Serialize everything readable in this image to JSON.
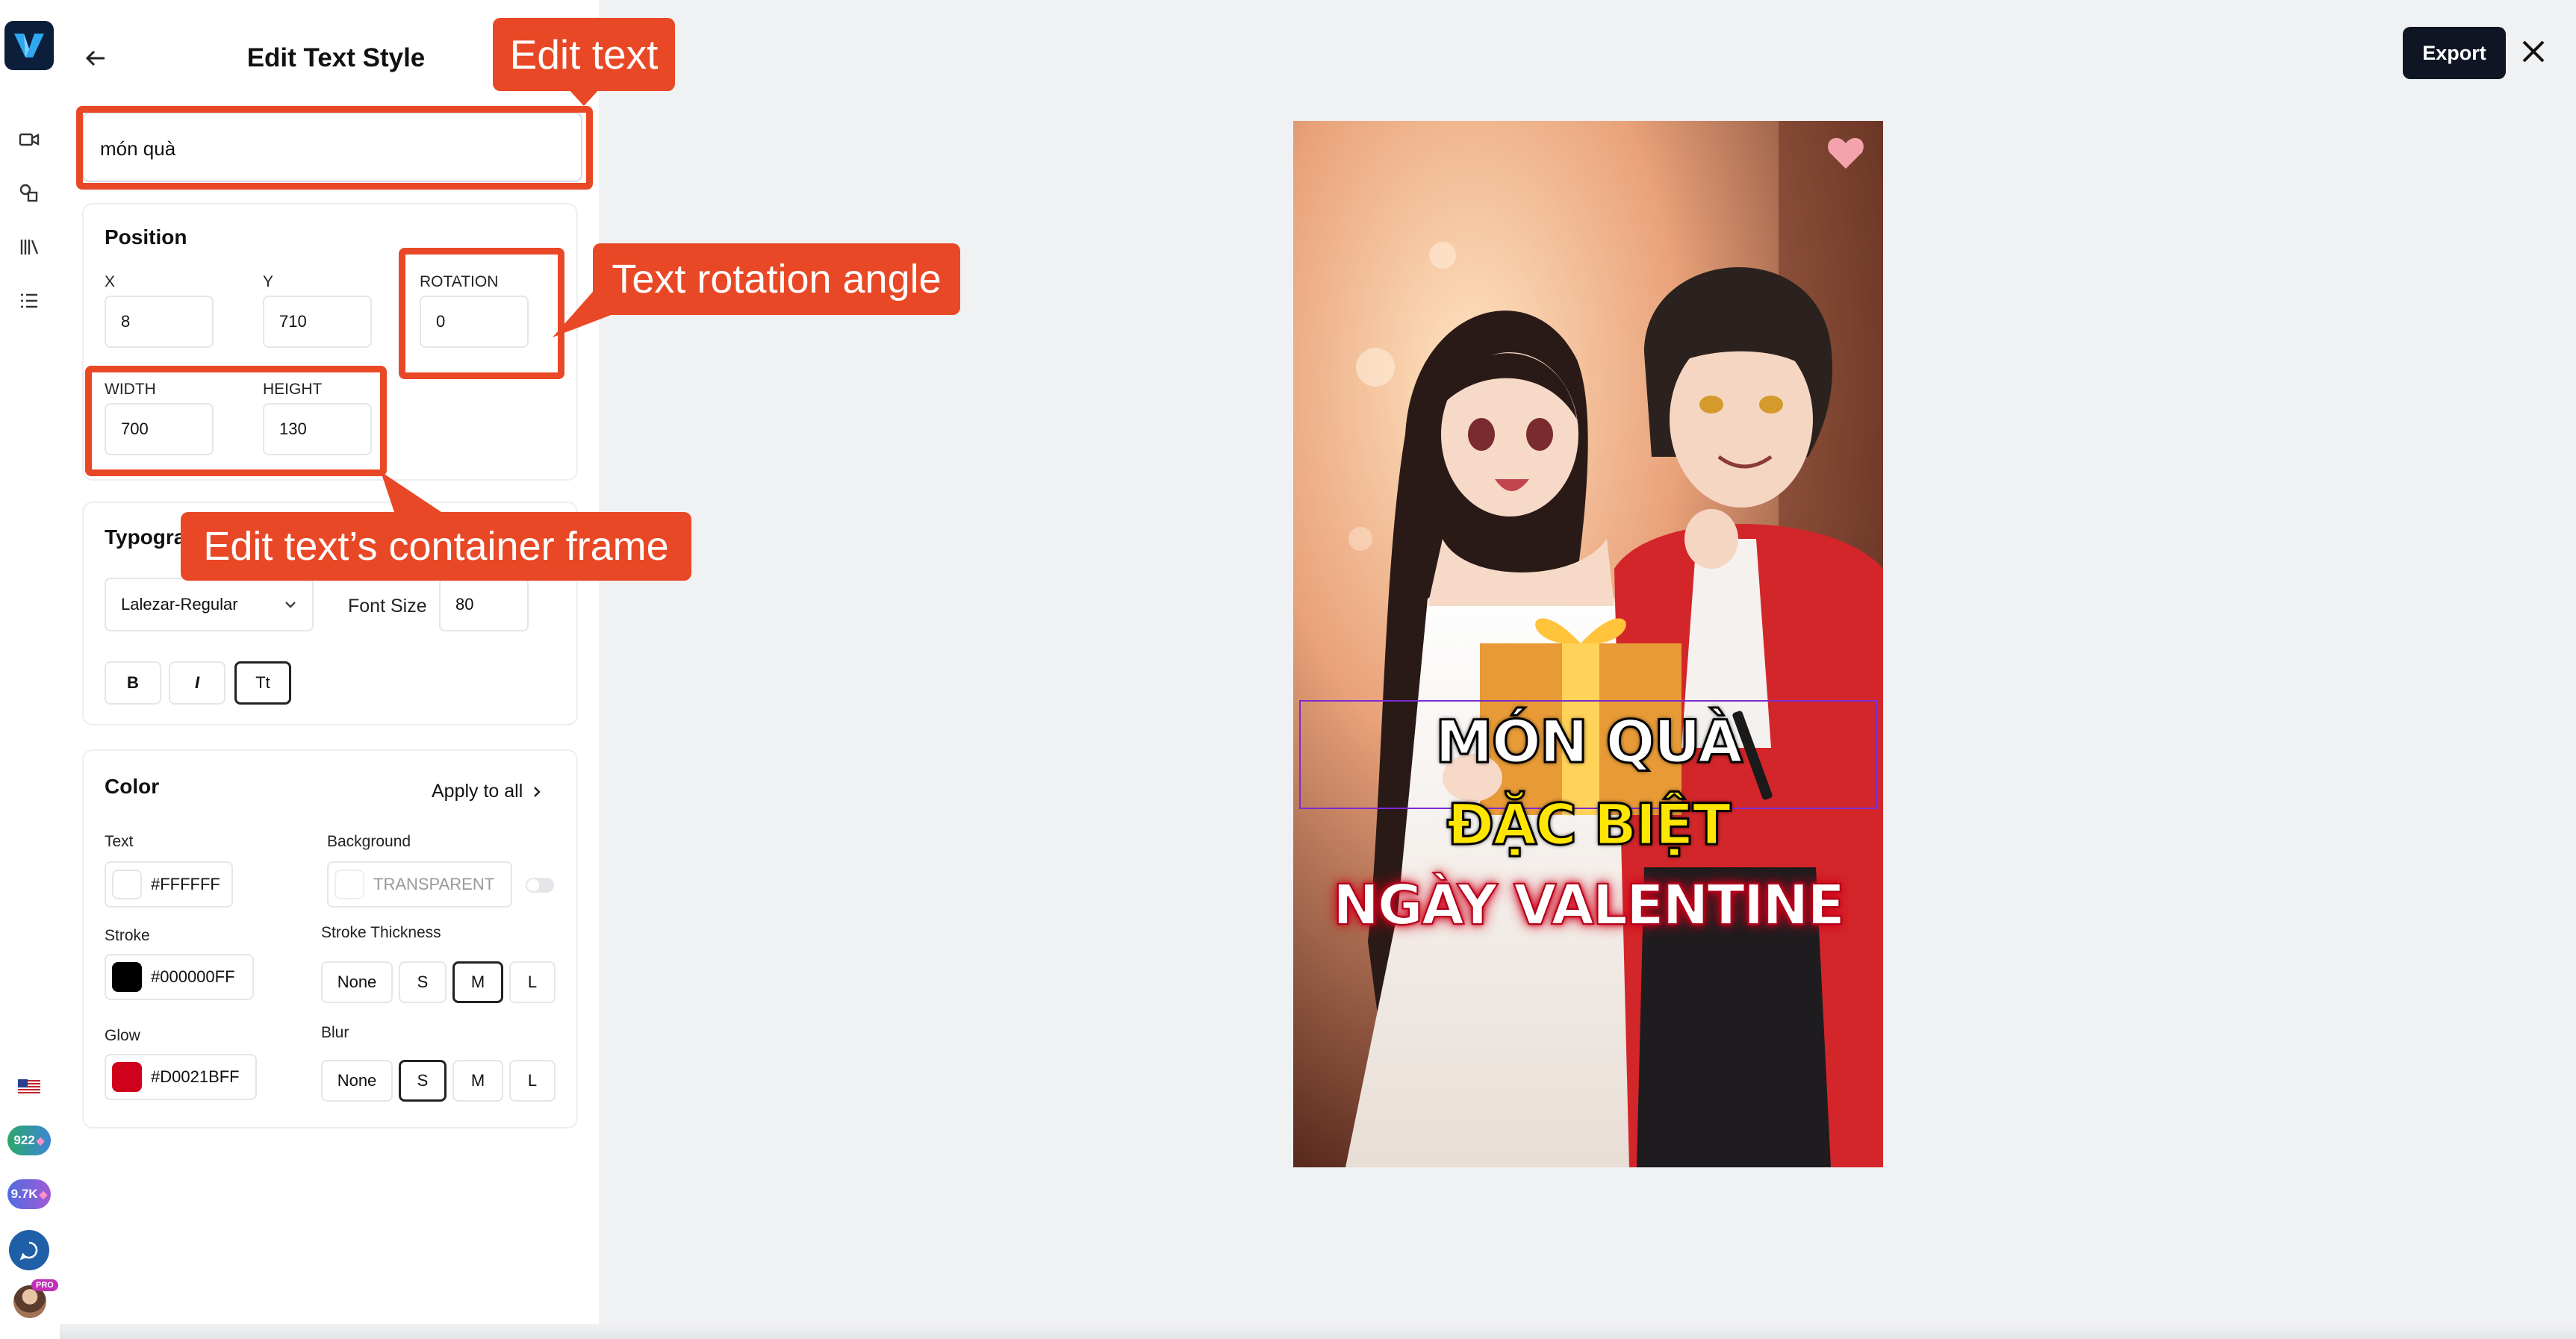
{
  "panel": {
    "title": "Edit Text Style",
    "text_value": "món quà"
  },
  "position": {
    "heading": "Position",
    "x_label": "X",
    "x_value": "8",
    "y_label": "Y",
    "y_value": "710",
    "rotation_label": "ROTATION",
    "rotation_value": "0",
    "width_label": "WIDTH",
    "width_value": "700",
    "height_label": "HEIGHT",
    "height_value": "130"
  },
  "typography": {
    "heading": "Typogra",
    "font_family": "Lalezar-Regular",
    "font_size_label": "Font Size",
    "font_size_value": "80",
    "bold_label": "B",
    "italic_label": "I",
    "case_label": "Tt"
  },
  "color": {
    "heading": "Color",
    "apply_all": "Apply to all",
    "text_label": "Text",
    "text_hex": "#FFFFFF",
    "background_label": "Background",
    "background_value": "TRANSPARENT",
    "stroke_label": "Stroke",
    "stroke_hex": "#000000FF",
    "stroke_thickness_label": "Stroke Thickness",
    "stroke_options": [
      "None",
      "S",
      "M",
      "L"
    ],
    "stroke_selected": "M",
    "glow_label": "Glow",
    "glow_hex": "#D0021BFF",
    "blur_label": "Blur",
    "blur_options": [
      "None",
      "S",
      "M",
      "L"
    ],
    "blur_selected": "S",
    "swatch_text": "#FFFFFF",
    "swatch_stroke": "#000000",
    "swatch_glow": "#D0021B"
  },
  "annotations": {
    "edit_text": "Edit text",
    "rotation": "Text rotation angle",
    "frame": "Edit text’s container frame",
    "color": "#E94826"
  },
  "header": {
    "export_label": "Export"
  },
  "rail": {
    "credit_1": "922",
    "credit_2": "9.7K",
    "pro_badge": "PRO"
  },
  "preview": {
    "line_1": "MÓN QUÀ",
    "line_2": "ĐẶC BIỆT",
    "line_3": "NGÀY VALENTINE",
    "line_2_color": "#FFE600",
    "glow_color": "#D0021B"
  }
}
